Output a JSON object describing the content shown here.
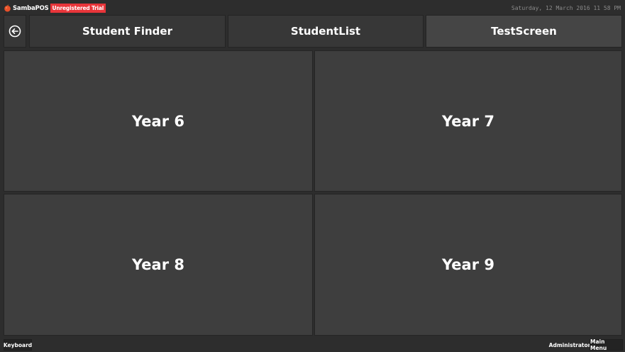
{
  "app": {
    "name": "SambaPOS",
    "badge": "Unregistered Trial",
    "datetime": "Saturday, 12 March 2016 11 58 PM"
  },
  "nav": {
    "tabs": [
      {
        "label": "Student Finder"
      },
      {
        "label": "StudentList"
      },
      {
        "label": "TestScreen"
      }
    ]
  },
  "tiles": [
    {
      "label": "Year 6"
    },
    {
      "label": "Year 7"
    },
    {
      "label": "Year 8"
    },
    {
      "label": "Year 9"
    }
  ],
  "footer": {
    "keyboard": "Keyboard",
    "user": "Administrator",
    "main_menu": "Main Menu"
  },
  "colors": {
    "background": "#2d2d2d",
    "tile": "#3e3e3e",
    "tab": "#373737",
    "tab_active": "#454545",
    "badge": "#e8353a"
  },
  "icons": {
    "logo": "sambapos-logo-icon",
    "back": "arrow-left-circle-icon"
  }
}
